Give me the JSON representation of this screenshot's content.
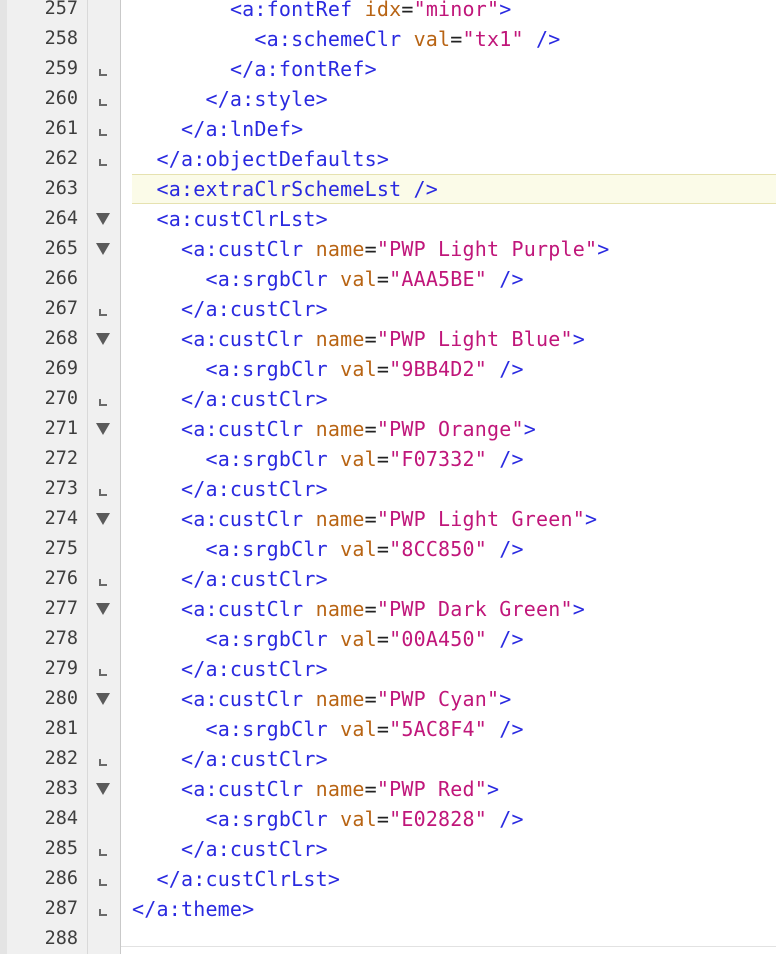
{
  "editor": {
    "colors": {
      "tag": "#2a2ae0",
      "attr": "#b86414",
      "value": "#c0167a",
      "line_number": "#3e3e3e",
      "highlight": "#fbfbe8"
    },
    "highlighted_line": 263,
    "lines": [
      {
        "num": "257",
        "fold": "none",
        "indent": "        ",
        "tokens": [
          {
            "k": "tag",
            "v": "<a:fontRef "
          },
          {
            "k": "attr",
            "v": "idx"
          },
          {
            "k": "eq",
            "v": "="
          },
          {
            "k": "val",
            "v": "\"minor\""
          },
          {
            "k": "tag",
            "v": ">"
          }
        ]
      },
      {
        "num": "258",
        "fold": "none",
        "indent": "          ",
        "tokens": [
          {
            "k": "tag",
            "v": "<a:schemeClr "
          },
          {
            "k": "attr",
            "v": "val"
          },
          {
            "k": "eq",
            "v": "="
          },
          {
            "k": "val",
            "v": "\"tx1\""
          },
          {
            "k": "tag",
            "v": " />"
          }
        ]
      },
      {
        "num": "259",
        "fold": "close",
        "indent": "        ",
        "tokens": [
          {
            "k": "tag",
            "v": "</a:fontRef>"
          }
        ]
      },
      {
        "num": "260",
        "fold": "close",
        "indent": "      ",
        "tokens": [
          {
            "k": "tag",
            "v": "</a:style>"
          }
        ]
      },
      {
        "num": "261",
        "fold": "close",
        "indent": "    ",
        "tokens": [
          {
            "k": "tag",
            "v": "</a:lnDef>"
          }
        ]
      },
      {
        "num": "262",
        "fold": "close",
        "indent": "  ",
        "tokens": [
          {
            "k": "tag",
            "v": "</a:objectDefaults>"
          }
        ]
      },
      {
        "num": "263",
        "fold": "none",
        "indent": "  ",
        "highlight": true,
        "tokens": [
          {
            "k": "tag",
            "v": "<a:extraClrSchemeLst />"
          }
        ]
      },
      {
        "num": "264",
        "fold": "open",
        "indent": "  ",
        "tokens": [
          {
            "k": "tag",
            "v": "<a:custClrLst>"
          }
        ]
      },
      {
        "num": "265",
        "fold": "open",
        "indent": "    ",
        "tokens": [
          {
            "k": "tag",
            "v": "<a:custClr "
          },
          {
            "k": "attr",
            "v": "name"
          },
          {
            "k": "eq",
            "v": "="
          },
          {
            "k": "val",
            "v": "\"PWP Light Purple\""
          },
          {
            "k": "tag",
            "v": ">"
          }
        ]
      },
      {
        "num": "266",
        "fold": "none",
        "indent": "      ",
        "tokens": [
          {
            "k": "tag",
            "v": "<a:srgbClr "
          },
          {
            "k": "attr",
            "v": "val"
          },
          {
            "k": "eq",
            "v": "="
          },
          {
            "k": "val",
            "v": "\"AAA5BE\""
          },
          {
            "k": "tag",
            "v": " />"
          }
        ]
      },
      {
        "num": "267",
        "fold": "close",
        "indent": "    ",
        "tokens": [
          {
            "k": "tag",
            "v": "</a:custClr>"
          }
        ]
      },
      {
        "num": "268",
        "fold": "open",
        "indent": "    ",
        "tokens": [
          {
            "k": "tag",
            "v": "<a:custClr "
          },
          {
            "k": "attr",
            "v": "name"
          },
          {
            "k": "eq",
            "v": "="
          },
          {
            "k": "val",
            "v": "\"PWP Light Blue\""
          },
          {
            "k": "tag",
            "v": ">"
          }
        ]
      },
      {
        "num": "269",
        "fold": "none",
        "indent": "      ",
        "tokens": [
          {
            "k": "tag",
            "v": "<a:srgbClr "
          },
          {
            "k": "attr",
            "v": "val"
          },
          {
            "k": "eq",
            "v": "="
          },
          {
            "k": "val",
            "v": "\"9BB4D2\""
          },
          {
            "k": "tag",
            "v": " />"
          }
        ]
      },
      {
        "num": "270",
        "fold": "close",
        "indent": "    ",
        "tokens": [
          {
            "k": "tag",
            "v": "</a:custClr>"
          }
        ]
      },
      {
        "num": "271",
        "fold": "open",
        "indent": "    ",
        "tokens": [
          {
            "k": "tag",
            "v": "<a:custClr "
          },
          {
            "k": "attr",
            "v": "name"
          },
          {
            "k": "eq",
            "v": "="
          },
          {
            "k": "val",
            "v": "\"PWP Orange\""
          },
          {
            "k": "tag",
            "v": ">"
          }
        ]
      },
      {
        "num": "272",
        "fold": "none",
        "indent": "      ",
        "tokens": [
          {
            "k": "tag",
            "v": "<a:srgbClr "
          },
          {
            "k": "attr",
            "v": "val"
          },
          {
            "k": "eq",
            "v": "="
          },
          {
            "k": "val",
            "v": "\"F07332\""
          },
          {
            "k": "tag",
            "v": " />"
          }
        ]
      },
      {
        "num": "273",
        "fold": "close",
        "indent": "    ",
        "tokens": [
          {
            "k": "tag",
            "v": "</a:custClr>"
          }
        ]
      },
      {
        "num": "274",
        "fold": "open",
        "indent": "    ",
        "tokens": [
          {
            "k": "tag",
            "v": "<a:custClr "
          },
          {
            "k": "attr",
            "v": "name"
          },
          {
            "k": "eq",
            "v": "="
          },
          {
            "k": "val",
            "v": "\"PWP Light Green\""
          },
          {
            "k": "tag",
            "v": ">"
          }
        ]
      },
      {
        "num": "275",
        "fold": "none",
        "indent": "      ",
        "tokens": [
          {
            "k": "tag",
            "v": "<a:srgbClr "
          },
          {
            "k": "attr",
            "v": "val"
          },
          {
            "k": "eq",
            "v": "="
          },
          {
            "k": "val",
            "v": "\"8CC850\""
          },
          {
            "k": "tag",
            "v": " />"
          }
        ]
      },
      {
        "num": "276",
        "fold": "close",
        "indent": "    ",
        "tokens": [
          {
            "k": "tag",
            "v": "</a:custClr>"
          }
        ]
      },
      {
        "num": "277",
        "fold": "open",
        "indent": "    ",
        "tokens": [
          {
            "k": "tag",
            "v": "<a:custClr "
          },
          {
            "k": "attr",
            "v": "name"
          },
          {
            "k": "eq",
            "v": "="
          },
          {
            "k": "val",
            "v": "\"PWP Dark Green\""
          },
          {
            "k": "tag",
            "v": ">"
          }
        ]
      },
      {
        "num": "278",
        "fold": "none",
        "indent": "      ",
        "tokens": [
          {
            "k": "tag",
            "v": "<a:srgbClr "
          },
          {
            "k": "attr",
            "v": "val"
          },
          {
            "k": "eq",
            "v": "="
          },
          {
            "k": "val",
            "v": "\"00A450\""
          },
          {
            "k": "tag",
            "v": " />"
          }
        ]
      },
      {
        "num": "279",
        "fold": "close",
        "indent": "    ",
        "tokens": [
          {
            "k": "tag",
            "v": "</a:custClr>"
          }
        ]
      },
      {
        "num": "280",
        "fold": "open",
        "indent": "    ",
        "tokens": [
          {
            "k": "tag",
            "v": "<a:custClr "
          },
          {
            "k": "attr",
            "v": "name"
          },
          {
            "k": "eq",
            "v": "="
          },
          {
            "k": "val",
            "v": "\"PWP Cyan\""
          },
          {
            "k": "tag",
            "v": ">"
          }
        ]
      },
      {
        "num": "281",
        "fold": "none",
        "indent": "      ",
        "tokens": [
          {
            "k": "tag",
            "v": "<a:srgbClr "
          },
          {
            "k": "attr",
            "v": "val"
          },
          {
            "k": "eq",
            "v": "="
          },
          {
            "k": "val",
            "v": "\"5AC8F4\""
          },
          {
            "k": "tag",
            "v": " />"
          }
        ]
      },
      {
        "num": "282",
        "fold": "close",
        "indent": "    ",
        "tokens": [
          {
            "k": "tag",
            "v": "</a:custClr>"
          }
        ]
      },
      {
        "num": "283",
        "fold": "open",
        "indent": "    ",
        "tokens": [
          {
            "k": "tag",
            "v": "<a:custClr "
          },
          {
            "k": "attr",
            "v": "name"
          },
          {
            "k": "eq",
            "v": "="
          },
          {
            "k": "val",
            "v": "\"PWP Red\""
          },
          {
            "k": "tag",
            "v": ">"
          }
        ]
      },
      {
        "num": "284",
        "fold": "none",
        "indent": "      ",
        "tokens": [
          {
            "k": "tag",
            "v": "<a:srgbClr "
          },
          {
            "k": "attr",
            "v": "val"
          },
          {
            "k": "eq",
            "v": "="
          },
          {
            "k": "val",
            "v": "\"E02828\""
          },
          {
            "k": "tag",
            "v": " />"
          }
        ]
      },
      {
        "num": "285",
        "fold": "close",
        "indent": "    ",
        "tokens": [
          {
            "k": "tag",
            "v": "</a:custClr>"
          }
        ]
      },
      {
        "num": "286",
        "fold": "close",
        "indent": "  ",
        "tokens": [
          {
            "k": "tag",
            "v": "</a:custClrLst>"
          }
        ]
      },
      {
        "num": "287",
        "fold": "close",
        "indent": "",
        "tokens": [
          {
            "k": "tag",
            "v": "</a:theme>"
          }
        ]
      },
      {
        "num": "288",
        "fold": "none",
        "indent": "",
        "tokens": []
      }
    ]
  }
}
